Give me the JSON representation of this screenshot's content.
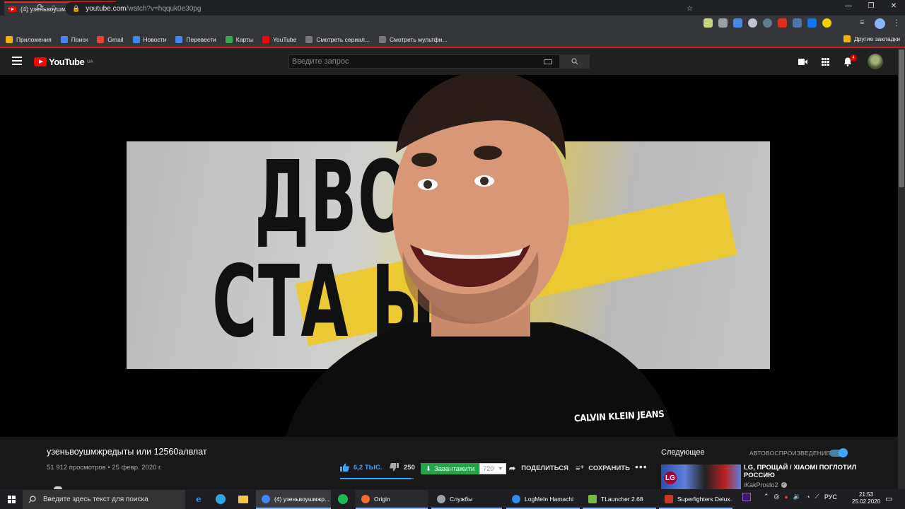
{
  "browser": {
    "tab_title": "(4) узеньвоушмжредыты и",
    "tab_close": "✕",
    "new_tab": "+",
    "window_controls": [
      "—",
      "❐",
      "✕"
    ],
    "url_host": "youtube.com",
    "url_path": "/watch?v=hqquk0e30pg",
    "bookmarks": [
      {
        "label": "Приложения",
        "icon": "apps-grid-icon",
        "color": "#f4b400"
      },
      {
        "label": "Поиск",
        "icon": "google-icon",
        "color": "#4285f4"
      },
      {
        "label": "Gmail",
        "icon": "gmail-icon",
        "color": "#ea4335"
      },
      {
        "label": "Новости",
        "icon": "news-icon",
        "color": "#4285f4"
      },
      {
        "label": "Перевести",
        "icon": "translate-icon",
        "color": "#4285f4"
      },
      {
        "label": "Карты",
        "icon": "maps-icon",
        "color": "#34a853"
      },
      {
        "label": "YouTube",
        "icon": "youtube-icon",
        "color": "#ff0000"
      },
      {
        "label": "Смотреть сериал...",
        "icon": "film-icon",
        "color": "#777777"
      },
      {
        "label": "Смотреть мультфи...",
        "icon": "film-icon",
        "color": "#777777"
      }
    ],
    "other_bookmarks": "Другие закладки"
  },
  "youtube": {
    "logo_text": "YouTube",
    "region": "UA",
    "search_placeholder": "Введите запрос",
    "notifications_count": "4",
    "video": {
      "title": "узеньвоушмжредыты или 12560алвлат",
      "views": "51 912 просмотров",
      "date": "25 февр. 2020 г.",
      "likes": "6,2 ТЫС.",
      "dislikes": "250",
      "like_ratio": 0.96,
      "download_label": "Завантажити",
      "quality": "720",
      "share_label": "ПОДЕЛИТЬСЯ",
      "save_label": "СОХРАНИТЬ",
      "more": "•••",
      "poster_line1": "ДВО  ЫЕ",
      "poster_line2": "СТА       Ы",
      "brand_watermark": "CALVIN KLEIN JEANS"
    },
    "sidebar": {
      "up_next": "Следующее",
      "autoplay": "АВТОВОСПРОИЗВЕДЕНИЕ",
      "autoplay_on": true,
      "recommended": [
        {
          "title": "LG, ПРОЩАЙ / XIAOMI ПОГЛОТИЛ РОССИЮ",
          "channel": "iKakProsto2",
          "thumb_logo": "LG"
        }
      ]
    }
  },
  "taskbar": {
    "search_placeholder": "Введите здесь текст для поиска",
    "apps": [
      {
        "label": "(4) узеньвоушмжр...",
        "icon": "chrome-icon",
        "color": "#4285f4"
      },
      {
        "label": "Origin",
        "icon": "origin-icon",
        "color": "#f56c2d"
      },
      {
        "label": "Службы",
        "icon": "services-gear-icon",
        "color": "#9aa0a6"
      },
      {
        "label": "LogMeIn Hamachi",
        "icon": "hamachi-icon",
        "color": "#2d8cf0"
      },
      {
        "label": "TLauncher 2.68",
        "icon": "tlauncher-icon",
        "color": "#7ab648"
      },
      {
        "label": "Superfighters Delux...",
        "icon": "superfighters-icon",
        "color": "#c0392b"
      }
    ],
    "language": "РУС",
    "time": "21:53",
    "date": "25.02.2020"
  }
}
